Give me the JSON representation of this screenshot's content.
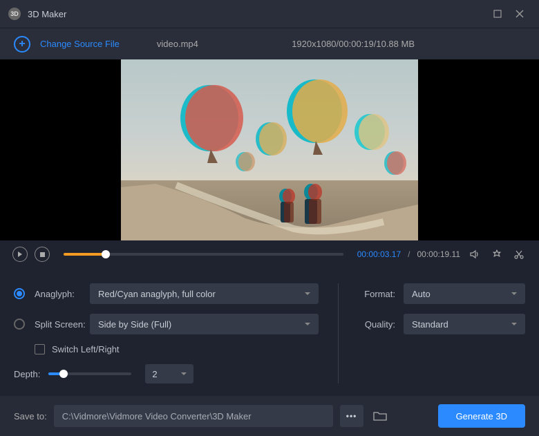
{
  "title": "3D Maker",
  "sourcebar": {
    "change_label": "Change Source File",
    "filename": "video.mp4",
    "meta": "1920x1080/00:00:19/10.88 MB"
  },
  "playback": {
    "current": "00:00:03.17",
    "total": "00:00:19.11"
  },
  "settings_left": {
    "anaglyph_label": "Anaglyph:",
    "anaglyph_value": "Red/Cyan anaglyph, full color",
    "split_label": "Split Screen:",
    "split_value": "Side by Side (Full)",
    "switch_label": "Switch Left/Right",
    "depth_label": "Depth:",
    "depth_value": "2"
  },
  "settings_right": {
    "format_label": "Format:",
    "format_value": "Auto",
    "quality_label": "Quality:",
    "quality_value": "Standard"
  },
  "footer": {
    "save_label": "Save to:",
    "save_path": "C:\\Vidmore\\Vidmore Video Converter\\3D Maker",
    "generate_label": "Generate 3D"
  }
}
